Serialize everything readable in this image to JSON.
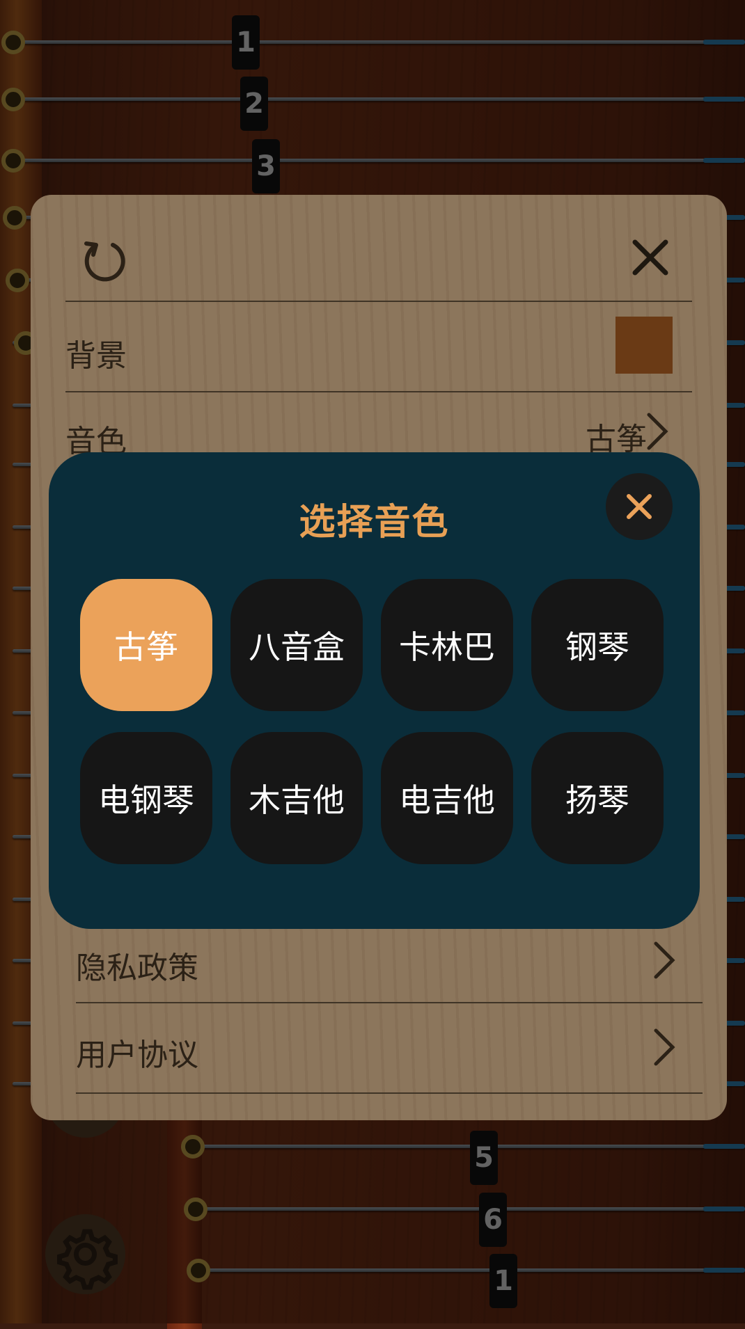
{
  "background": {
    "string_numbers_top": [
      "1",
      "2",
      "3"
    ],
    "string_numbers_bottom": [
      "5",
      "6",
      "1"
    ]
  },
  "settings": {
    "rows": [
      {
        "label": "背景",
        "value": ""
      },
      {
        "label": "音色",
        "value": "古筝"
      },
      {
        "label": "隐私政策",
        "value": ""
      },
      {
        "label": "用户协议",
        "value": ""
      }
    ],
    "background_swatch_color": "#6a3a15"
  },
  "picker": {
    "title": "选择音色",
    "options": [
      "古筝",
      "八音盒",
      "卡林巴",
      "钢琴",
      "电钢琴",
      "木吉他",
      "电吉他",
      "扬琴"
    ],
    "selected": "古筝",
    "accent_color": "#eba25a"
  },
  "icons": {
    "reset": "refresh-icon",
    "close": "close-icon",
    "chevron": "chevron-right-icon",
    "gear": "gear-icon"
  }
}
